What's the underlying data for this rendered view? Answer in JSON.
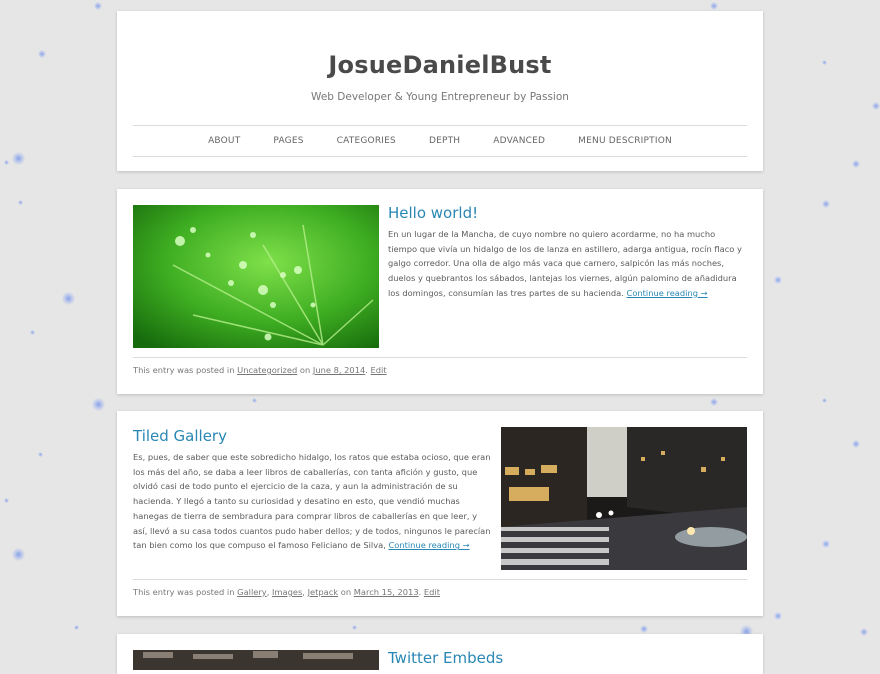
{
  "site": {
    "title": "JosueDanielBust",
    "description": "Web Developer & Young Entrepreneur by Passion"
  },
  "nav": {
    "items": [
      "ABOUT",
      "PAGES",
      "CATEGORIES",
      "DEPTH",
      "ADVANCED",
      "MENU DESCRIPTION"
    ]
  },
  "posts": [
    {
      "title": "Hello world!",
      "excerpt": "En un lugar de la Mancha, de cuyo nombre no quiero acordarme, no ha mucho tiempo que vivía un hidalgo de los de lanza en astillero, adarga antigua, rocín flaco y galgo corredor. Una olla de algo más vaca que carnero, salpicón las más noches, duelos y quebrantos los sábados, lantejas los viernes, algún palomino de añadidura los domingos, consumían las tres partes de su hacienda.",
      "more": "Continue reading →",
      "meta_prefix": "This entry was posted in",
      "categories": [
        "Uncategorized"
      ],
      "meta_on": "on",
      "date": "June 8, 2014",
      "edit": "Edit",
      "image": "green-leaf-with-water-drops"
    },
    {
      "title": "Tiled Gallery",
      "excerpt": "Es, pues, de saber que este sobredicho hidalgo, los ratos que estaba ocioso, que eran los más del año, se daba a leer libros de caballerías, con tanta afición y gusto, que olvidó casi de todo punto el ejercicio de la caza, y aun la administración de su hacienda. Y llegó a tanto su curiosidad y desatino en esto, que vendió muchas hanegas de tierra de sembradura para comprar libros de caballerías en que leer, y así, llevó a su casa todos cuantos pudo haber dellos; y de todos, ningunos le parecían tan bien como los que compuso el famoso Feliciano de Silva,",
      "more": "Continue reading →",
      "meta_prefix": "This entry was posted in",
      "categories": [
        "Gallery",
        "Images",
        "Jetpack"
      ],
      "meta_on": "on",
      "date": "March 15, 2013",
      "edit": "Edit",
      "image": "city-street-at-night"
    },
    {
      "title": "Twitter Embeds",
      "image": "street-scene"
    }
  ]
}
